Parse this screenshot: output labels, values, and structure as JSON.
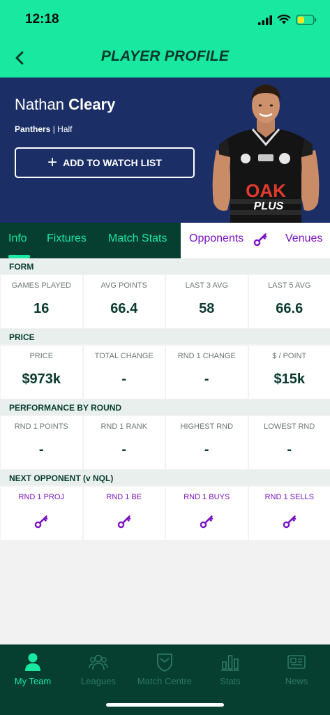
{
  "status_bar": {
    "time": "12:18"
  },
  "header": {
    "title": "PLAYER PROFILE"
  },
  "player": {
    "first_name": "Nathan",
    "last_name": "Cleary",
    "team": "Panthers",
    "position": "| Half",
    "watch_button_label": "ADD TO WATCH LIST",
    "jersey_text": [
      "OAK",
      "PLUS"
    ]
  },
  "tabs": [
    {
      "label": "Info"
    },
    {
      "label": "Fixtures"
    },
    {
      "label": "Match Stats"
    },
    {
      "label": "Opponents"
    },
    {
      "label": "Venues"
    }
  ],
  "sections": {
    "form": {
      "title": "FORM",
      "stats": [
        {
          "label": "GAMES PLAYED",
          "value": "16"
        },
        {
          "label": "AVG POINTS",
          "value": "66.4"
        },
        {
          "label": "LAST 3 AVG",
          "value": "58"
        },
        {
          "label": "LAST 5 AVG",
          "value": "66.6"
        }
      ]
    },
    "price": {
      "title": "PRICE",
      "stats": [
        {
          "label": "PRICE",
          "value": "$973k"
        },
        {
          "label": "TOTAL CHANGE",
          "value": "-"
        },
        {
          "label": "RND 1 CHANGE",
          "value": "-"
        },
        {
          "label": "$ / POINT",
          "value": "$15k"
        }
      ]
    },
    "performance": {
      "title": "PERFORMANCE BY ROUND",
      "stats": [
        {
          "label": "RND 1 POINTS",
          "value": "-"
        },
        {
          "label": "RND 1 RANK",
          "value": "-"
        },
        {
          "label": "HIGHEST RND",
          "value": "-"
        },
        {
          "label": "LOWEST RND",
          "value": "-"
        }
      ]
    },
    "next_opponent": {
      "title": "NEXT OPPONENT (v NQL)",
      "stats": [
        {
          "label": "RND 1 PROJ",
          "icon": "key-icon"
        },
        {
          "label": "RND 1 BE",
          "icon": "key-icon"
        },
        {
          "label": "RND 1 BUYS",
          "icon": "key-icon"
        },
        {
          "label": "RND 1 SELLS",
          "icon": "key-icon"
        }
      ]
    }
  },
  "bottom_nav": [
    {
      "label": "My Team",
      "icon": "person-icon",
      "active": true
    },
    {
      "label": "Leagues",
      "icon": "group-icon",
      "active": false
    },
    {
      "label": "Match Centre",
      "icon": "shield-icon",
      "active": false
    },
    {
      "label": "Stats",
      "icon": "bar-chart-icon",
      "active": false
    },
    {
      "label": "News",
      "icon": "newspaper-icon",
      "active": false
    }
  ],
  "colors": {
    "accent_green": "#19e8a0",
    "dark_green": "#063e30",
    "navy": "#1b2f66",
    "purple": "#7b12c4"
  }
}
